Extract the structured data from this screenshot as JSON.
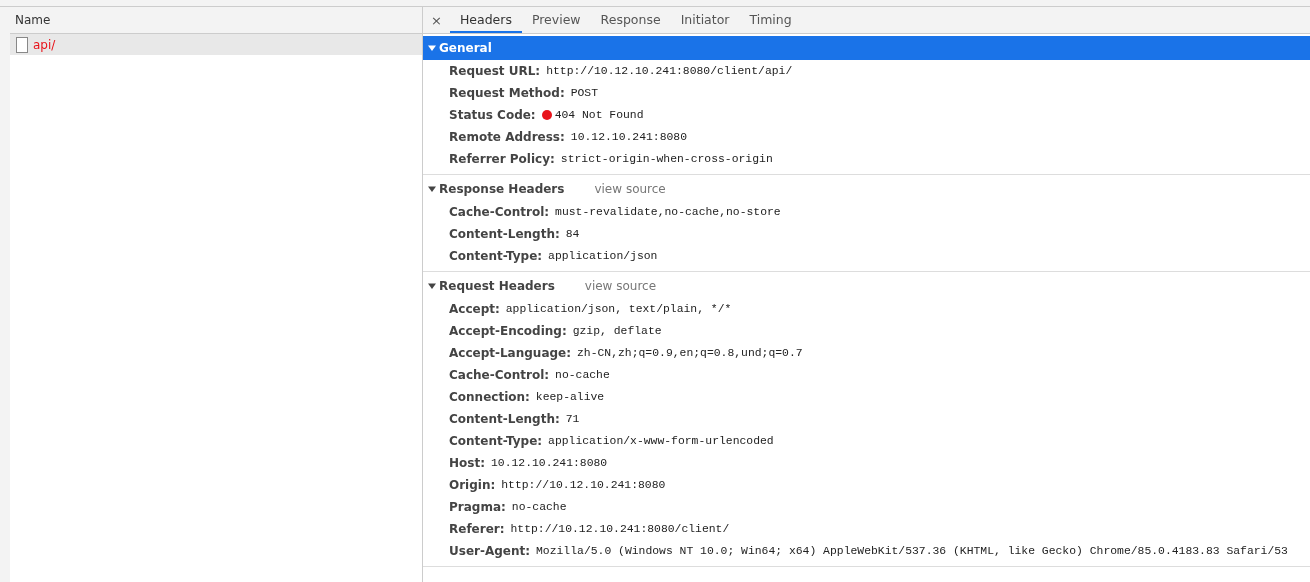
{
  "request_list": {
    "column": "Name",
    "rows": [
      {
        "name": "api/",
        "error": true,
        "selected": true
      }
    ]
  },
  "details": {
    "close": "×",
    "tabs": [
      {
        "label": "Headers",
        "selected": true
      },
      {
        "label": "Preview",
        "selected": false
      },
      {
        "label": "Response",
        "selected": false
      },
      {
        "label": "Initiator",
        "selected": false
      },
      {
        "label": "Timing",
        "selected": false
      }
    ],
    "sections": [
      {
        "title": "General",
        "expanded": true,
        "highlighted": true,
        "rows": [
          {
            "kind": "text",
            "name": "Request URL:",
            "value": "http://10.12.10.241:8080/client/api/"
          },
          {
            "kind": "text",
            "name": "Request Method:",
            "value": "POST"
          },
          {
            "kind": "status",
            "name": "Status Code:",
            "value": "404 Not Found",
            "color": "#e8131a"
          },
          {
            "kind": "text",
            "name": "Remote Address:",
            "value": "10.12.10.241:8080"
          },
          {
            "kind": "text",
            "name": "Referrer Policy:",
            "value": "strict-origin-when-cross-origin"
          }
        ]
      },
      {
        "title": "Response Headers",
        "link": "view source",
        "expanded": true,
        "highlighted": false,
        "rows": [
          {
            "kind": "text",
            "name": "Cache-Control:",
            "value": "must-revalidate,no-cache,no-store"
          },
          {
            "kind": "text",
            "name": "Content-Length:",
            "value": "84"
          },
          {
            "kind": "text",
            "name": "Content-Type:",
            "value": "application/json"
          }
        ]
      },
      {
        "title": "Request Headers",
        "link": "view source",
        "expanded": true,
        "highlighted": false,
        "rows": [
          {
            "kind": "text",
            "name": "Accept:",
            "value": "application/json, text/plain, */*"
          },
          {
            "kind": "text",
            "name": "Accept-Encoding:",
            "value": "gzip, deflate"
          },
          {
            "kind": "text",
            "name": "Accept-Language:",
            "value": "zh-CN,zh;q=0.9,en;q=0.8,und;q=0.7"
          },
          {
            "kind": "text",
            "name": "Cache-Control:",
            "value": "no-cache"
          },
          {
            "kind": "text",
            "name": "Connection:",
            "value": "keep-alive"
          },
          {
            "kind": "text",
            "name": "Content-Length:",
            "value": "71"
          },
          {
            "kind": "text",
            "name": "Content-Type:",
            "value": "application/x-www-form-urlencoded"
          },
          {
            "kind": "text",
            "name": "Host:",
            "value": "10.12.10.241:8080"
          },
          {
            "kind": "text",
            "name": "Origin:",
            "value": "http://10.12.10.241:8080"
          },
          {
            "kind": "text",
            "name": "Pragma:",
            "value": "no-cache"
          },
          {
            "kind": "text",
            "name": "Referer:",
            "value": "http://10.12.10.241:8080/client/"
          },
          {
            "kind": "text",
            "name": "User-Agent:",
            "value": "Mozilla/5.0 (Windows NT 10.0; Win64; x64) AppleWebKit/537.36 (KHTML, like Gecko) Chrome/85.0.4183.83 Safari/53"
          }
        ]
      }
    ]
  }
}
